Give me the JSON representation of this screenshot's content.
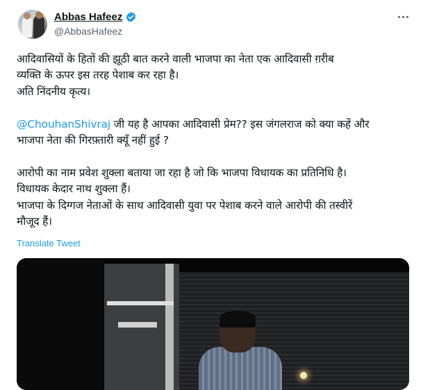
{
  "author": {
    "display_name": "Abbas Hafeez",
    "handle": "@AbbasHafeez",
    "verified": true,
    "avatar_icon": "profile-photo",
    "more_icon": "more-horizontal-icon"
  },
  "tweet": {
    "lines": [
      "आदिवासियों के हितों की झूठी बात करने वाली भाजपा का नेता एक आदिवासी ग़रीब",
      "व्यक्ति के ऊपर इस तरह पेशाब कर रहा है।",
      "अति निंदनीय कृत्य।"
    ],
    "mention": "@ChouhanShivraj",
    "mention_rest": " जी यह है आपका आदिवासी प्रेम?? इस जंगलराज को क्या कहें और",
    "line_after_mention": "भाजपा नेता की गिरफ़्तारी क्यूँ नहीं हुई ?",
    "para3": [
      "आरोपी का नाम प्रवेश शुक्ला बताया जा रहा है जो कि भाजपा विधायक का प्रतिनिधि है।",
      "विधायक केदार नाथ शुक्ला हैं।",
      "भाजपा के दिग्गज नेताओं के साथ आदिवासी युवा पर पेशाब करने वाले आरोपी की तस्वीरें",
      "मौजूद हैं।"
    ],
    "translate_label": "Translate Tweet"
  },
  "colors": {
    "link": "#1d9bf0",
    "text": "#0f1419",
    "secondary": "#536471"
  }
}
